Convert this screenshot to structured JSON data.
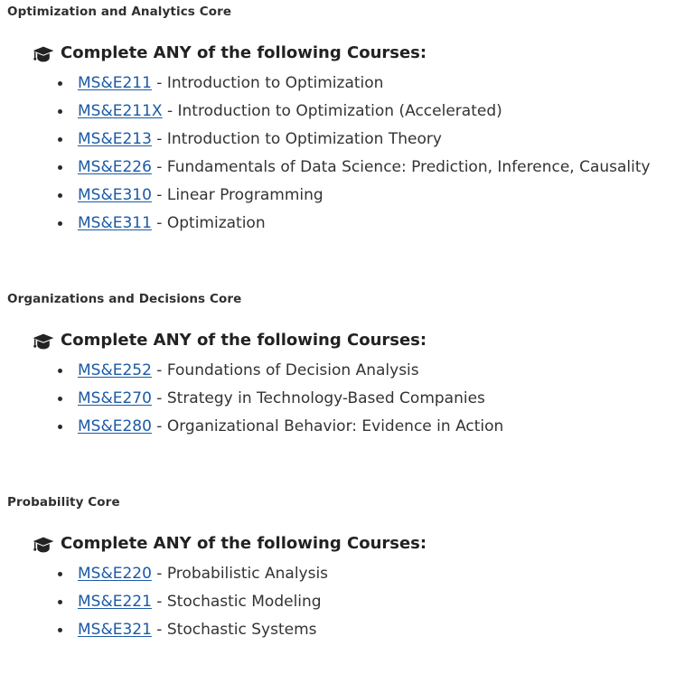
{
  "page": {
    "background_color": "#ffffff",
    "link_color": "#1b5aa6",
    "text_color": "#333333",
    "heading_color": "#2f2f2f"
  },
  "groups": [
    {
      "title": "Optimization and Analytics Core",
      "rule": {
        "icon": "graduation-cap-icon",
        "text": "Complete ANY of the following Courses:"
      },
      "courses": [
        {
          "code": "MS&E211",
          "sep": "-",
          "title": "Introduction to Optimization"
        },
        {
          "code": "MS&E211X",
          "sep": "-",
          "title": "Introduction to Optimization (Accelerated)"
        },
        {
          "code": "MS&E213",
          "sep": "-",
          "title": "Introduction to Optimization Theory"
        },
        {
          "code": "MS&E226",
          "sep": "-",
          "title": "Fundamentals of Data Science: Prediction, Inference, Causality"
        },
        {
          "code": "MS&E310",
          "sep": "-",
          "title": "Linear Programming"
        },
        {
          "code": "MS&E311",
          "sep": "-",
          "title": "Optimization"
        }
      ]
    },
    {
      "title": "Organizations and Decisions Core",
      "rule": {
        "icon": "graduation-cap-icon",
        "text": "Complete ANY of the following Courses:"
      },
      "courses": [
        {
          "code": "MS&E252",
          "sep": "-",
          "title": "Foundations of Decision Analysis"
        },
        {
          "code": "MS&E270",
          "sep": "-",
          "title": "Strategy in Technology-Based Companies"
        },
        {
          "code": "MS&E280",
          "sep": "-",
          "title": "Organizational Behavior: Evidence in Action"
        }
      ]
    },
    {
      "title": "Probability Core",
      "rule": {
        "icon": "graduation-cap-icon",
        "text": "Complete ANY of the following Courses:"
      },
      "courses": [
        {
          "code": "MS&E220",
          "sep": "-",
          "title": "Probabilistic Analysis"
        },
        {
          "code": "MS&E221",
          "sep": "-",
          "title": "Stochastic Modeling"
        },
        {
          "code": "MS&E321",
          "sep": "-",
          "title": "Stochastic Systems"
        }
      ]
    }
  ]
}
